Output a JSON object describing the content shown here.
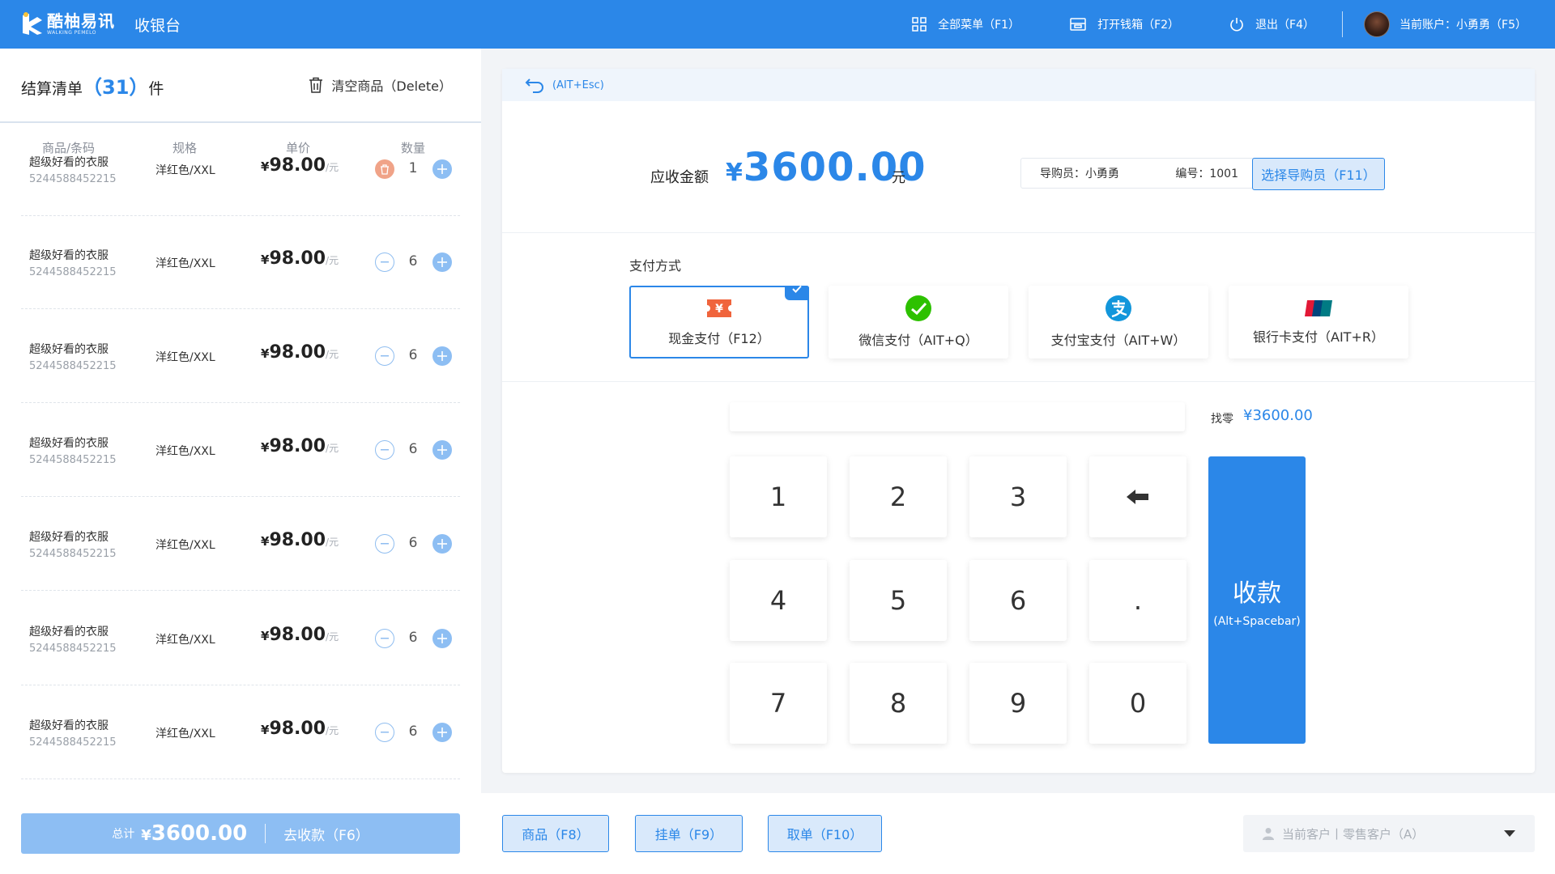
{
  "header": {
    "logo_name": "酷柚易讯",
    "logo_sub": "WALKING PEMELO",
    "app_title": "收银台",
    "nav": [
      {
        "label": "全部菜单（F1）"
      },
      {
        "label": "打开钱箱（F2）"
      },
      {
        "label": "退出（F4）"
      }
    ],
    "user_label": "当前账户：小勇勇（F5）"
  },
  "cart": {
    "title": "结算清单",
    "count": "（31）",
    "unit": "件",
    "clear_label": "清空商品（Delete）",
    "columns": [
      "商品/条码",
      "规格",
      "单价",
      "数量"
    ],
    "items": [
      {
        "name": "超级好看的衣服",
        "code": "5244588452215",
        "spec": "洋红色/XXL",
        "price": "98.00",
        "qty": "1"
      },
      {
        "name": "超级好看的衣服",
        "code": "5244588452215",
        "spec": "洋红色/XXL",
        "price": "98.00",
        "qty": "6"
      },
      {
        "name": "超级好看的衣服",
        "code": "5244588452215",
        "spec": "洋红色/XXL",
        "price": "98.00",
        "qty": "6"
      },
      {
        "name": "超级好看的衣服",
        "code": "5244588452215",
        "spec": "洋红色/XXL",
        "price": "98.00",
        "qty": "6"
      },
      {
        "name": "超级好看的衣服",
        "code": "5244588452215",
        "spec": "洋红色/XXL",
        "price": "98.00",
        "qty": "6"
      },
      {
        "name": "超级好看的衣服",
        "code": "5244588452215",
        "spec": "洋红色/XXL",
        "price": "98.00",
        "qty": "6"
      },
      {
        "name": "超级好看的衣服",
        "code": "5244588452215",
        "spec": "洋红色/XXL",
        "price": "98.00",
        "qty": "6"
      }
    ],
    "currency": "¥",
    "price_unit": "/元",
    "checkout": {
      "total_label": "总计",
      "total": "3600.00",
      "action": "去收款（F6）"
    }
  },
  "payment": {
    "back_shortcut": "(AIT+Esc)",
    "due_label": "应收金额",
    "due_amount": "3600.00",
    "due_unit": "元",
    "guide_name": "导购员：小勇勇",
    "guide_id": "编号：1001",
    "guide_button": "选择导购员（F11）",
    "method_title": "支付方式",
    "methods": [
      {
        "label": "现金支付（F12）",
        "icon": "cash-icon",
        "selected": true
      },
      {
        "label": "微信支付（AIT+Q）",
        "icon": "wechat-icon",
        "selected": false
      },
      {
        "label": "支付宝支付（AIT+W）",
        "icon": "alipay-icon",
        "selected": false
      },
      {
        "label": "银行卡支付（AIT+R）",
        "icon": "unionpay-icon",
        "selected": false
      }
    ],
    "input_value": "",
    "change_label": "找零",
    "change_value": "¥3600.00",
    "keys": [
      "1",
      "2",
      "3",
      "←",
      "4",
      "5",
      "6",
      ".",
      "7",
      "8",
      "9",
      "0"
    ],
    "pay_button": "收款",
    "pay_shortcut": "(Alt+Spacebar)"
  },
  "footer": {
    "buttons": [
      "商品（F8）",
      "挂单（F9）",
      "取单（F10）"
    ],
    "customer": "当前客户丨零售客户（A）"
  },
  "colors": {
    "primary": "#2b87e8",
    "light": "#8dbef3",
    "cash": "#f0643c",
    "wechat": "#2dc100",
    "alipay": "#1296db"
  }
}
